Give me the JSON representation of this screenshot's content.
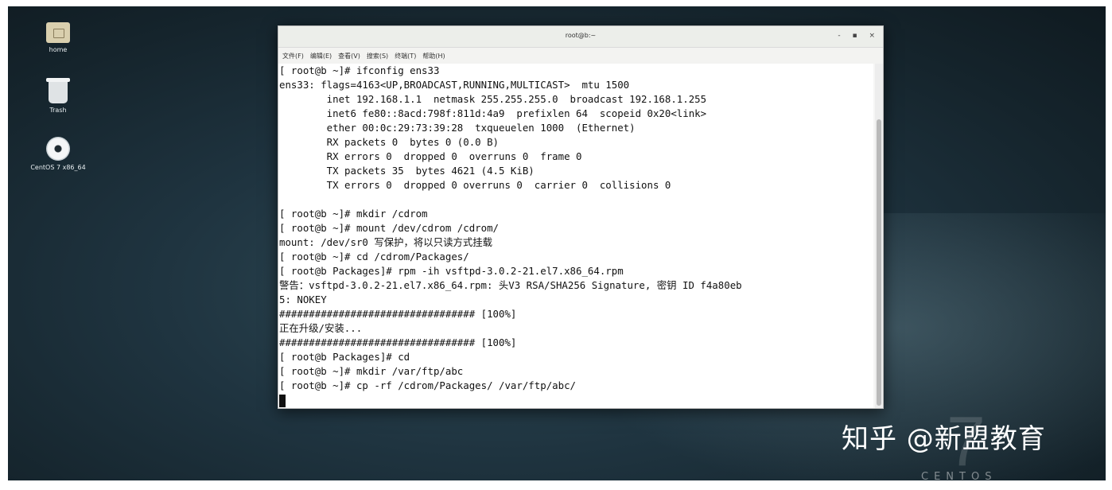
{
  "desktop": {
    "icons": [
      {
        "label": "home",
        "icon": "folder-home-icon"
      },
      {
        "label": "Trash",
        "icon": "trash-icon"
      },
      {
        "label": "CentOS 7 x86_64",
        "icon": "optical-disc-icon"
      }
    ],
    "brand": {
      "number": "7",
      "word": "CENTOS"
    }
  },
  "window": {
    "title": "root@b:~",
    "controls": [
      "-",
      "▪",
      "×"
    ],
    "menu": [
      "文件(F)",
      "编辑(E)",
      "查看(V)",
      "搜索(S)",
      "终端(T)",
      "帮助(H)"
    ]
  },
  "terminal": {
    "lines": [
      "[ root@b ~]# ifconfig ens33",
      "ens33: flags=4163<UP,BROADCAST,RUNNING,MULTICAST>  mtu 1500",
      "        inet 192.168.1.1  netmask 255.255.255.0  broadcast 192.168.1.255",
      "        inet6 fe80::8acd:798f:811d:4a9  prefixlen 64  scopeid 0x20<link>",
      "        ether 00:0c:29:73:39:28  txqueuelen 1000  (Ethernet)",
      "        RX packets 0  bytes 0 (0.0 B)",
      "        RX errors 0  dropped 0  overruns 0  frame 0",
      "        TX packets 35  bytes 4621 (4.5 KiB)",
      "        TX errors 0  dropped 0 overruns 0  carrier 0  collisions 0",
      "",
      "[ root@b ~]# mkdir /cdrom",
      "[ root@b ~]# mount /dev/cdrom /cdrom/",
      "mount: /dev/sr0 写保护，将以只读方式挂载",
      "[ root@b ~]# cd /cdrom/Packages/",
      "[ root@b Packages]# rpm -ih vsftpd-3.0.2-21.el7.x86_64.rpm",
      "警告：vsftpd-3.0.2-21.el7.x86_64.rpm: 头V3 RSA/SHA256 Signature, 密钥 ID f4a80eb",
      "5: NOKEY",
      "################################# [100%]",
      "正在升级/安装...",
      "################################# [100%]",
      "[ root@b Packages]# cd",
      "[ root@b ~]# mkdir /var/ftp/abc",
      "[ root@b ~]# cp -rf /cdrom/Packages/ /var/ftp/abc/"
    ]
  },
  "watermark": "知乎 @新盟教育"
}
